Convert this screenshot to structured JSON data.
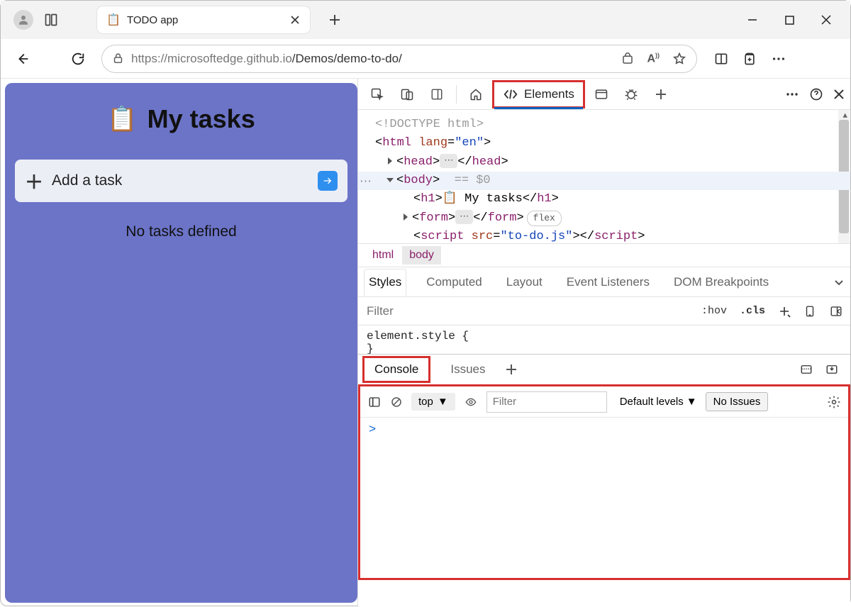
{
  "browser": {
    "tab_title": "TODO app",
    "url_host": "https://microsoftedge.github.io",
    "url_path": "/Demos/demo-to-do/"
  },
  "page": {
    "heading": "My tasks",
    "addtask_label": "Add a task",
    "empty_msg": "No tasks defined"
  },
  "devtools": {
    "elements_tab": "Elements",
    "dom": {
      "doctype": "<!DOCTYPE html>",
      "html_open": "html",
      "html_lang_attr": "lang",
      "html_lang_val": "\"en\"",
      "head": "head",
      "body": "body",
      "body_marker": "== $0",
      "h1": "h1",
      "h1_text": " My tasks",
      "form": "form",
      "flex_badge": "flex",
      "script": "script",
      "script_attr": "src",
      "script_val": "\"to-do.js\""
    },
    "breadcrumb": {
      "i0": "html",
      "i1": "body"
    },
    "subtabs": {
      "styles": "Styles",
      "computed": "Computed",
      "layout": "Layout",
      "listeners": "Event Listeners",
      "dombp": "DOM Breakpoints"
    },
    "filter_placeholder": "Filter",
    "hov": ":hov",
    "cls": ".cls",
    "style_body_l1": "element.style {",
    "style_body_l2": "}",
    "drawer": {
      "console": "Console",
      "issues": "Issues",
      "context": "top",
      "filter_placeholder": "Filter",
      "levels": "Default levels",
      "noissues": "No Issues",
      "prompt": ">"
    }
  }
}
